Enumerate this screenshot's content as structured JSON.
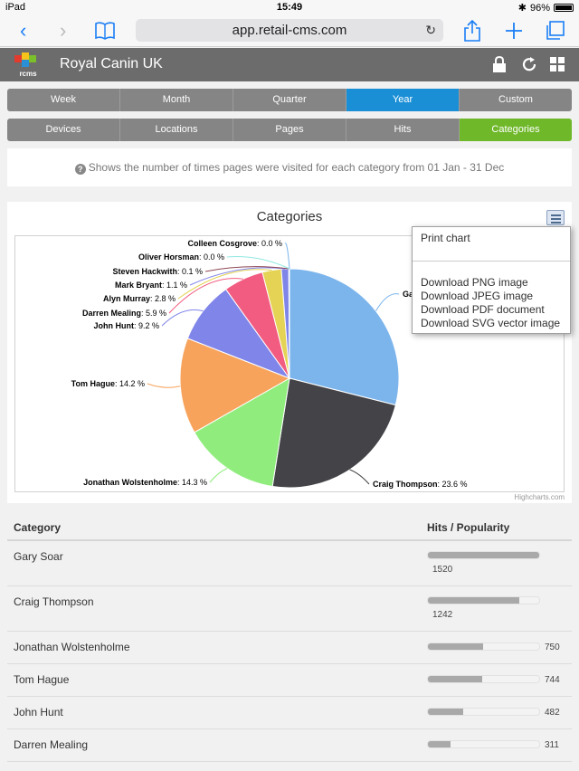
{
  "status_bar": {
    "device": "iPad",
    "time": "15:49",
    "battery": "96%"
  },
  "browser": {
    "url": "app.retail-cms.com"
  },
  "app": {
    "logo_text": "rcms",
    "title": "Royal Canin UK"
  },
  "period_tabs": [
    {
      "label": "Week"
    },
    {
      "label": "Month"
    },
    {
      "label": "Quarter"
    },
    {
      "label": "Year",
      "active": true
    },
    {
      "label": "Custom"
    }
  ],
  "metric_tabs": [
    {
      "label": "Devices"
    },
    {
      "label": "Locations"
    },
    {
      "label": "Pages"
    },
    {
      "label": "Hits"
    },
    {
      "label": "Categories",
      "active": true
    }
  ],
  "info_text": "Shows the number of times pages were visited for each category from 01 Jan - 31 Dec",
  "chart_menu": {
    "print": "Print chart",
    "items": [
      "Download PNG image",
      "Download JPEG image",
      "Download PDF document",
      "Download SVG vector image"
    ]
  },
  "chart_credits": "Highcharts.com",
  "chart_data": {
    "type": "pie",
    "title": "Categories",
    "slices": [
      {
        "name": "Gary Soar",
        "label": "Ga",
        "value": 29.0,
        "color": "#7cb5ec"
      },
      {
        "name": "Craig Thompson",
        "label": "Craig Thompson: 23.6 %",
        "value": 23.6,
        "color": "#434348"
      },
      {
        "name": "Jonathan Wolstenholme",
        "label": "Jonathan Wolstenholme: 14.3 %",
        "value": 14.3,
        "color": "#90ed7d"
      },
      {
        "name": "Tom Hague",
        "label": "Tom Hague: 14.2 %",
        "value": 14.2,
        "color": "#f7a35c"
      },
      {
        "name": "John Hunt",
        "label": "John Hunt: 9.2 %",
        "value": 9.2,
        "color": "#8085e9"
      },
      {
        "name": "Darren Mealing",
        "label": "Darren Mealing: 5.9 %",
        "value": 5.9,
        "color": "#f15c80"
      },
      {
        "name": "Alyn Murray",
        "label": "Alyn Murray: 2.8 %",
        "value": 2.8,
        "color": "#e4d354"
      },
      {
        "name": "Mark Bryant",
        "label": "Mark Bryant: 1.1 %",
        "value": 1.1,
        "color": "#8085e8"
      },
      {
        "name": "Steven Hackwith",
        "label": "Steven Hackwith: 0.1 %",
        "value": 0.1,
        "color": "#8d4653"
      },
      {
        "name": "Oliver Horsman",
        "label": "Oliver Horsman: 0.0 %",
        "value": 0.0,
        "color": "#91e8e1"
      },
      {
        "name": "Colleen Cosgrove",
        "label": "Colleen Cosgrove: 0.0 %",
        "value": 0.0,
        "color": "#7cb5ec"
      }
    ]
  },
  "table": {
    "headers": {
      "category": "Category",
      "hits": "Hits / Popularity"
    },
    "max": 1520,
    "rows": [
      {
        "category": "Gary Soar",
        "hits": "1520",
        "value": 1520
      },
      {
        "category": "Craig Thompson",
        "hits": "1242",
        "value": 1242
      },
      {
        "category": "Jonathan Wolstenholme",
        "hits": "750",
        "value": 750
      },
      {
        "category": "Tom Hague",
        "hits": "744",
        "value": 744
      },
      {
        "category": "John Hunt",
        "hits": "482",
        "value": 482
      },
      {
        "category": "Darren Mealing",
        "hits": "311",
        "value": 311
      }
    ]
  }
}
